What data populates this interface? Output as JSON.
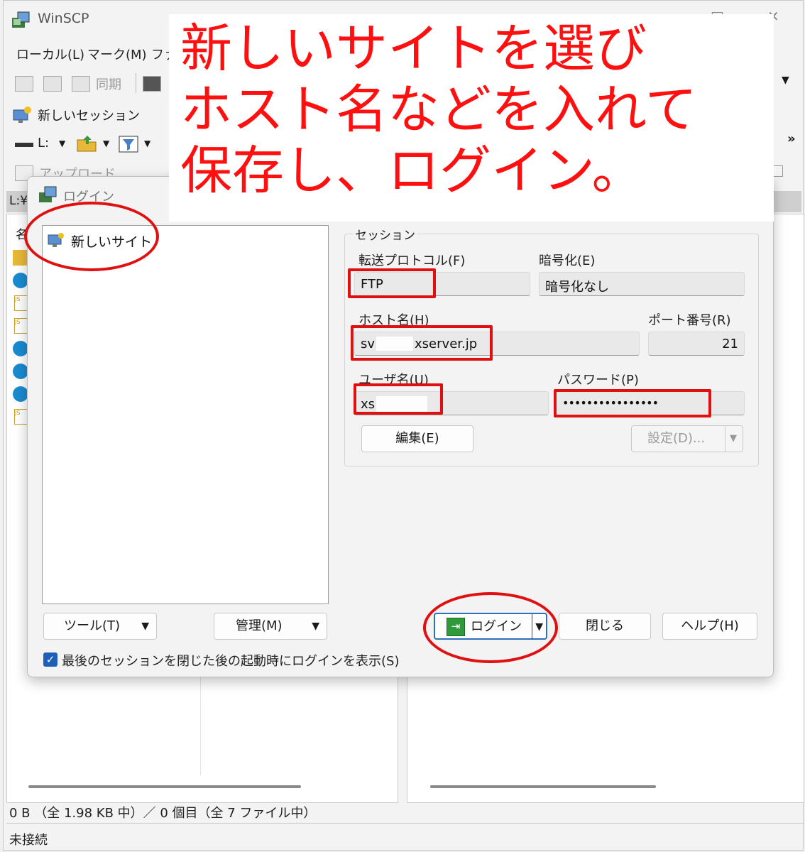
{
  "app": {
    "title": "WinSCP",
    "window_controls": [
      "□",
      "✕"
    ]
  },
  "menu": {
    "items": [
      "ローカル(L)",
      "マーク(M)",
      "ファ"
    ]
  },
  "toolbar": {
    "sync_label": "同期",
    "new_session_label": "新しいセッション",
    "drive_label": "L:",
    "upload_label": "アップロード",
    "overflow": "»"
  },
  "left_panel": {
    "path": "L:¥",
    "column_name": "名"
  },
  "status": {
    "line1": "0 B （全 1.98 KB 中）／ 0 個目（全 7 ファイル中）",
    "line2": "未接続"
  },
  "dialog": {
    "title": "ログイン",
    "site_tree": {
      "items": [
        "新しいサイト"
      ]
    },
    "session_group_label": "セッション",
    "protocol_label": "転送プロトコル(F)",
    "protocol_value": "FTP",
    "encryption_label": "暗号化(E)",
    "encryption_value": "暗号化なし",
    "host_label": "ホスト名(H)",
    "host_value_prefix": "sv",
    "host_value_suffix": "xserver.jp",
    "port_label": "ポート番号(R)",
    "port_value": "21",
    "user_label": "ユーザ名(U)",
    "user_value": "xs",
    "password_label": "パスワード(P)",
    "password_value": "••••••••••••••••",
    "edit_button": "編集(E)",
    "settings_button": "設定(D)...",
    "tools_button": "ツール(T)",
    "manage_button": "管理(M)",
    "login_button": "ログイン",
    "close_button": "閉じる",
    "help_button": "ヘルプ(H)",
    "show_login_checkbox": "最後のセッションを閉じた後の起動時にログインを表示(S)",
    "show_login_checked": true
  },
  "annotation": {
    "lines": [
      "新しいサイトを選び",
      "ホスト名などを入れて",
      "保存し、ログイン。"
    ],
    "color": "#e01010"
  }
}
